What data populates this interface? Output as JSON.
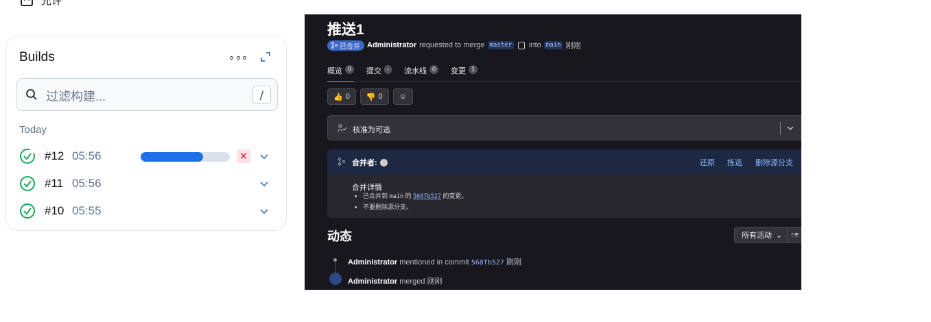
{
  "top_item": {
    "label": "允许",
    "icon": "account-box-icon"
  },
  "builds_panel": {
    "title": "Builds",
    "filter_placeholder": "过滤构建...",
    "filter_shortcut": "/",
    "group_label": "Today",
    "rows": [
      {
        "number": "#12",
        "time": "05:56",
        "status": "success",
        "in_progress": true,
        "progress": 0.7
      },
      {
        "number": "#11",
        "time": "05:56",
        "status": "success",
        "in_progress": false
      },
      {
        "number": "#10",
        "time": "05:55",
        "status": "success",
        "in_progress": false
      }
    ],
    "colors": {
      "success": "#1aaa55",
      "accent": "#1f6fe8",
      "cancel": "#e0303b"
    }
  },
  "merge_request": {
    "title": "推送1",
    "badge": "已合并",
    "author": "Administrator",
    "requested_text": "requested to merge",
    "source_branch": "master",
    "into_text": "into",
    "target_branch": "main",
    "time": "刚刚",
    "tabs": [
      {
        "label": "概览",
        "count": "0"
      },
      {
        "label": "提交",
        "count": "-"
      },
      {
        "label": "流水线",
        "count": "0"
      },
      {
        "label": "变更",
        "count": "1"
      }
    ],
    "reactions": {
      "thumbs_up": "0",
      "thumbs_down": "0"
    },
    "approval_text": "核准为可选",
    "merger_label": "合并者:",
    "actions": [
      "还原",
      "拣选",
      "删除源分支"
    ],
    "details_title": "合并详情",
    "detail_1_prefix": "已合并到",
    "detail_1_branch": "main",
    "detail_1_of": "的",
    "detail_1_sha": "568fb527",
    "detail_1_suffix": "的变更。",
    "detail_2": "不要删除源分支。",
    "activity_title": "动态",
    "activity_filter": "所有活动",
    "activity": [
      {
        "author": "Administrator",
        "text": "mentioned in commit",
        "sha": "568fb527",
        "time": "刚刚"
      },
      {
        "author": "Administrator",
        "text": "merged",
        "time": "刚刚"
      }
    ]
  }
}
